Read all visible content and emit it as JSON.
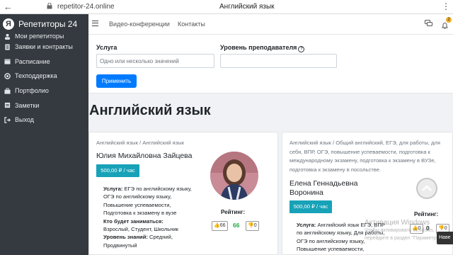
{
  "browser": {
    "url": "repetitor-24.online",
    "page_title": "Английский язык"
  },
  "sidebar": {
    "brand": "Репетиторы 24",
    "items": [
      {
        "label": "Мои репетиторы",
        "icon": "users-icon"
      },
      {
        "label": "Заявки и контракты",
        "icon": "document-icon"
      },
      {
        "label": "Расписание",
        "icon": "calendar-icon"
      },
      {
        "label": "Техподдержка",
        "icon": "support-icon"
      },
      {
        "label": "Портфолио",
        "icon": "briefcase-icon"
      },
      {
        "label": "Заметки",
        "icon": "note-icon"
      },
      {
        "label": "Выход",
        "icon": "logout-icon"
      }
    ]
  },
  "topbar": {
    "links": [
      "Видео-конференции",
      "Контакты"
    ],
    "notifications_count": "2"
  },
  "filter": {
    "subject_label": "Услуга",
    "subject_placeholder": "Одно или несколько значений",
    "level_label": "Уровень преподавателя",
    "help_glyph": "?",
    "apply_button": "Применить"
  },
  "page": {
    "heading": "Английский язык"
  },
  "cards": [
    {
      "breadcrumb": "Английский язык / Английский язык",
      "name": "Юлия Михайловна Зайцева",
      "price": "500,00 ₽ / час",
      "service_label": "Услуга:",
      "service_text": "ЕГЭ по английскому языку, ОГЭ по английскому языку, Повышение успеваемости, Подготовка к экзамену в вузе",
      "who_label": "Кто будет заниматься:",
      "who_text": "Взрослый, Студент, Школьник",
      "level_label": "Уровень знаний:",
      "level_text": "Средний, Продвинутый",
      "rating_label": "Рейтинг:",
      "likes": "66",
      "score": "66",
      "dislikes": "0"
    },
    {
      "breadcrumb": "Английский язык / Общий английский, ЕГЭ, для работы, для себя, ВПР, ОГЭ, повышение успеваемости, подготовка к международному экзамену, подготовка к экзамену в ВУЗе, подготовка к экзамену в посольстве.",
      "name": "Елена Геннадьевна Воронина",
      "price": "500,00 ₽ / час",
      "service_label": "Услуга:",
      "service_text": "Английский язык ЕГЭ, ВПР по английскому языку, Для работы, ОГЭ по английскому языку, Повышение успеваемости,",
      "rating_label": "Рейтинг:",
      "likes": "0",
      "score": "0",
      "dislikes": "0"
    }
  ],
  "overlay": {
    "watermark_line1": "Активация Windows",
    "watermark_line2": "Чтобы активировать Windows, перейдите в раздел \"Параметры\".",
    "nav_tip": "Наве"
  }
}
